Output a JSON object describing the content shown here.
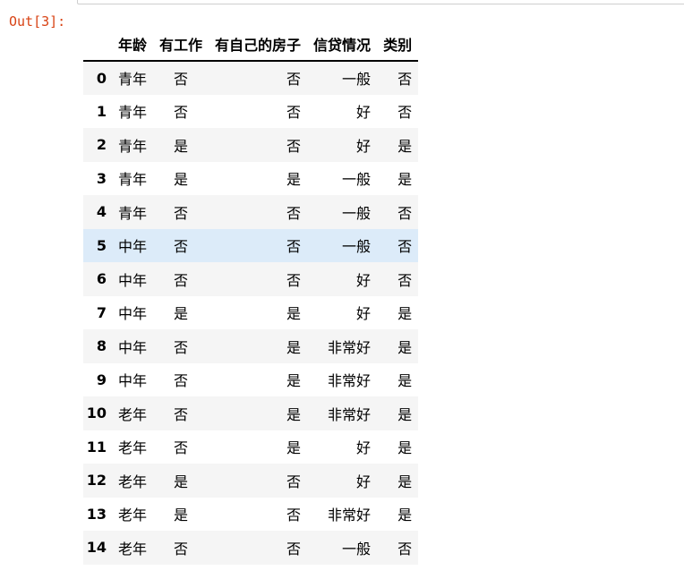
{
  "prompt": "Out[3]:",
  "columns": {
    "index": "",
    "age": "年龄",
    "job": "有工作",
    "house": "有自己的房子",
    "credit": "信贷情况",
    "label": "类别"
  },
  "rows": [
    {
      "index": "0",
      "age": "青年",
      "job": "否",
      "house": "否",
      "credit": "一般",
      "label": "否"
    },
    {
      "index": "1",
      "age": "青年",
      "job": "否",
      "house": "否",
      "credit": "好",
      "label": "否"
    },
    {
      "index": "2",
      "age": "青年",
      "job": "是",
      "house": "否",
      "credit": "好",
      "label": "是"
    },
    {
      "index": "3",
      "age": "青年",
      "job": "是",
      "house": "是",
      "credit": "一般",
      "label": "是"
    },
    {
      "index": "4",
      "age": "青年",
      "job": "否",
      "house": "否",
      "credit": "一般",
      "label": "否"
    },
    {
      "index": "5",
      "age": "中年",
      "job": "否",
      "house": "否",
      "credit": "一般",
      "label": "否"
    },
    {
      "index": "6",
      "age": "中年",
      "job": "否",
      "house": "否",
      "credit": "好",
      "label": "否"
    },
    {
      "index": "7",
      "age": "中年",
      "job": "是",
      "house": "是",
      "credit": "好",
      "label": "是"
    },
    {
      "index": "8",
      "age": "中年",
      "job": "否",
      "house": "是",
      "credit": "非常好",
      "label": "是"
    },
    {
      "index": "9",
      "age": "中年",
      "job": "否",
      "house": "是",
      "credit": "非常好",
      "label": "是"
    },
    {
      "index": "10",
      "age": "老年",
      "job": "否",
      "house": "是",
      "credit": "非常好",
      "label": "是"
    },
    {
      "index": "11",
      "age": "老年",
      "job": "否",
      "house": "是",
      "credit": "好",
      "label": "是"
    },
    {
      "index": "12",
      "age": "老年",
      "job": "是",
      "house": "否",
      "credit": "好",
      "label": "是"
    },
    {
      "index": "13",
      "age": "老年",
      "job": "是",
      "house": "否",
      "credit": "非常好",
      "label": "是"
    },
    {
      "index": "14",
      "age": "老年",
      "job": "否",
      "house": "否",
      "credit": "一般",
      "label": "否"
    }
  ],
  "highlighted_row": "5",
  "colors": {
    "prompt": "#d84315",
    "row_stripe": "#f5f5f5",
    "row_hover": "#dcebf9"
  }
}
